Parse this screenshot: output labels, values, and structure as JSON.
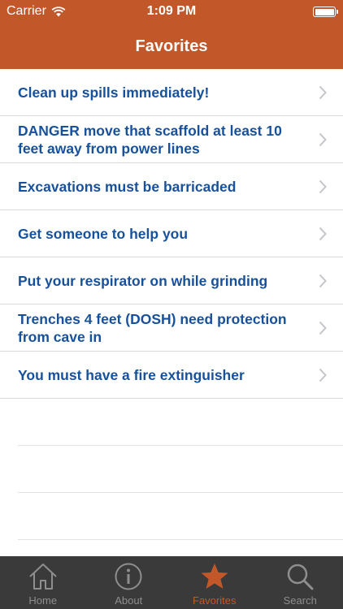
{
  "status_bar": {
    "carrier": "Carrier",
    "time": "1:09 PM"
  },
  "nav": {
    "title": "Favorites"
  },
  "favorites": [
    {
      "text": "Clean up spills immediately!"
    },
    {
      "text": "DANGER move that scaffold at least 10 feet away from power lines"
    },
    {
      "text": "Excavations must be barricaded"
    },
    {
      "text": "Get someone to help you"
    },
    {
      "text": "Put your respirator on while grinding"
    },
    {
      "text": "Trenches 4 feet (DOSH) need protection from cave in"
    },
    {
      "text": "You must have a fire extinguisher"
    }
  ],
  "tabs": [
    {
      "label": "Home",
      "icon": "house-icon",
      "active": false
    },
    {
      "label": "About",
      "icon": "info-icon",
      "active": false
    },
    {
      "label": "Favorites",
      "icon": "star-icon",
      "active": true
    },
    {
      "label": "Search",
      "icon": "magnifier-icon",
      "active": false
    }
  ],
  "colors": {
    "accent": "#c2582a",
    "link_text": "#17519c",
    "tab_bar": "#3a3a3a",
    "tab_inactive": "#8e8e8e"
  }
}
